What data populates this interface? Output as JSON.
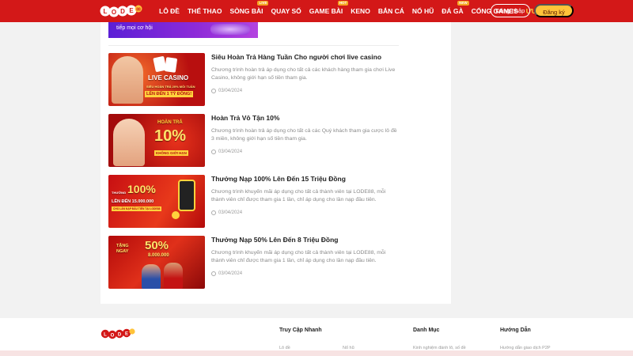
{
  "header": {
    "nav": [
      {
        "label": "LÔ ĐỀ",
        "badge": ""
      },
      {
        "label": "THỂ THAO",
        "badge": ""
      },
      {
        "label": "SÒNG BÀI",
        "badge": "LIVE"
      },
      {
        "label": "QUAY SỐ",
        "badge": ""
      },
      {
        "label": "GAME BÀI",
        "badge": "HOT"
      },
      {
        "label": "KENO",
        "badge": ""
      },
      {
        "label": "BẮN CÁ",
        "badge": ""
      },
      {
        "label": "NỔ HŨ",
        "badge": ""
      },
      {
        "label": "ĐÁ GÀ",
        "badge": "NEW"
      },
      {
        "label": "CỔNG GAMES",
        "badge": ""
      },
      {
        "label": "ƯU ĐÃI",
        "badge": ""
      }
    ],
    "login_label": "Đăng nhập",
    "register_label": "Đăng ký"
  },
  "top_banner_text": "tiếp mọi cơ hội",
  "posts": [
    {
      "title": "Siêu Hoàn Trả Hàng Tuần Cho người chơi live casino",
      "desc": "Chương trình hoàn trả áp dụng cho tất cả các khách hàng tham gia chơi Live Casino, không giới hạn số tiền tham gia.",
      "date": "03/04/2024",
      "thumb_text": [
        "LIVE CASINO",
        "SIÊU HOÀN TRẢ 20% MỖI TUẦN",
        "LÊN ĐẾN 1 TỶ ĐỒNG!"
      ]
    },
    {
      "title": "Hoàn Trả Vô Tận 10%",
      "desc": "Chương trình hoàn trả áp dụng cho tất cả các Quý khách tham gia cược lô đề 3 miền, không giới hạn số tiền tham gia.",
      "date": "03/04/2024",
      "thumb_text": [
        "HOÀN TRẢ",
        "10%",
        "KHÔNG GIỚI HẠN"
      ]
    },
    {
      "title": "Thưởng Nạp 100% Lên Đến 15 Triệu Đồng",
      "desc": "Chương trình khuyến mãi áp dụng cho tất cả thành viên tại LODE88, mỗi thành viên chỉ được tham gia 1 lần, chỉ áp dụng cho lần nạp đầu tiên.",
      "date": "03/04/2024",
      "thumb_text": [
        "100%",
        "THƯỞNG",
        "LÊN ĐẾN 15.000.000",
        "CHO LẦN NẠP ĐẦU TIÊN TẠI LODE88"
      ]
    },
    {
      "title": "Thưởng Nạp 50% Lên Đến 8 Triệu Đồng",
      "desc": "Chương trình khuyến mãi áp dụng cho tất cả thành viên tại LODE88, mỗi thành viên chỉ được tham gia 1 lần, chỉ áp dụng cho lần nạp đầu tiên.",
      "date": "03/04/2024",
      "thumb_text": [
        "TẶNG NGAY",
        "50%",
        "8.000.000"
      ]
    }
  ],
  "footer": {
    "columns": [
      {
        "title": "Truy Cập Nhanh"
      },
      {
        "title": "Danh Mục"
      },
      {
        "title": "Hướng Dẫn"
      }
    ],
    "links": [
      "Lô đề",
      "Nổ hũ",
      "Kinh nghiệm đánh lô, số đề",
      "Hướng dẫn giao dịch P2P"
    ]
  },
  "colors": {
    "header_bg": "#d31818",
    "active_nav": "#ffd23c",
    "register_bg": "#ffc33a"
  }
}
